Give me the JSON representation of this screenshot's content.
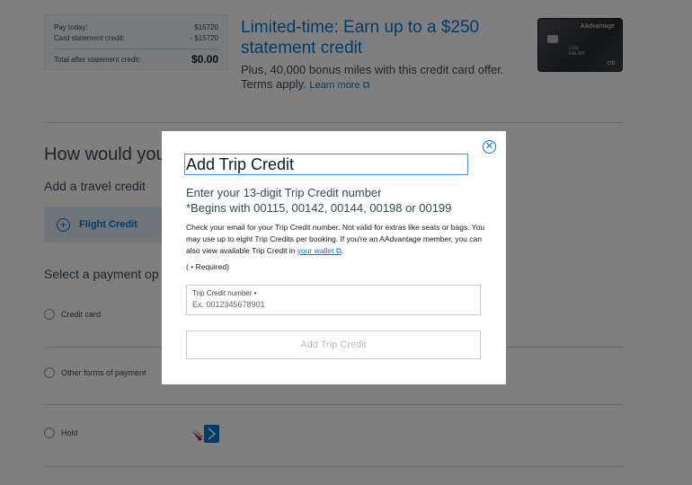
{
  "summary": {
    "rows": [
      {
        "label": "Pay today:",
        "value": "$15720"
      },
      {
        "label": "Card statement credit:",
        "value": "- $15720"
      }
    ],
    "total_label": "Total after statement credit:",
    "total_value": "$0.00"
  },
  "promo": {
    "title": "Limited-time: Earn up to a $250 statement credit",
    "text": "Plus, 40,000 bonus miles with this credit card offer. Terms apply.",
    "learn_more": "Learn more ⧉"
  },
  "card": {
    "brand": "AAdvantage",
    "holder_line1": "LUIS",
    "holder_line2": "KALANI",
    "issuer": "citi"
  },
  "background": {
    "heading": "How would you",
    "add_credit": "Add a travel credit",
    "flight_credit": "Flight Credit",
    "select_payment": "Select a payment op",
    "options": [
      "Credit card",
      "Other forms of payment",
      "Hold"
    ]
  },
  "modal": {
    "title": "Add Trip Credit",
    "subtitle_line1": "Enter your 13-digit Trip Credit number",
    "subtitle_line2": "*Begins with 00115, 00142, 00144, 00198 or 00199",
    "description": "Check your email for your Trip Credit number. Not valid for extras like seats or bags. You may use up to eight Trip Credits per booking. If you're an AAdvantage member, you can also view available Trip Credit in",
    "wallet_link": "your wallet ⧉",
    "description_end": ".",
    "required_open": "(",
    "required_star": "•",
    "required_text": "Required)",
    "field_label": "Trip Credit number",
    "field_star": "•",
    "field_placeholder": "Ex. 0012345678901",
    "field_value": "",
    "submit_label": "Add Trip Credit",
    "close_symbol": "✕"
  },
  "icons": {
    "close": "close-icon",
    "plus": "plus-icon"
  },
  "colors": {
    "accent": "#0078d2",
    "required": "#c30019",
    "overlay": "rgba(0,0,0,0.5)"
  }
}
